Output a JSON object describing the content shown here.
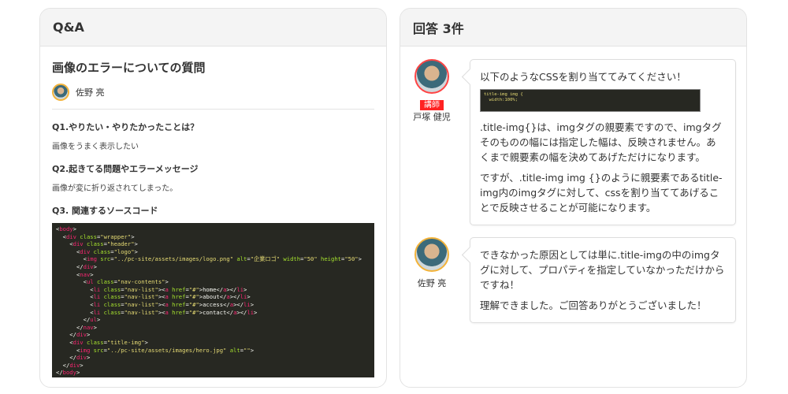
{
  "left": {
    "header": "Q&A",
    "title": "画像のエラーについての質問",
    "author": "佐野 亮",
    "q1": "Q1.やりたい・やりたかったことは？",
    "a1": "画像をうまく表示したい",
    "q2": "Q2.起きてる問題やエラーメッセージ",
    "a2": "画像が変に折り返されてしまった。",
    "q3": "Q3. 関連するソースコード",
    "code": [
      "<body>",
      "  <div class=\"wrapper\">",
      "    <div class=\"header\">",
      "      <div class=\"logo\">",
      "        <img src=\"../pc-site/assets/images/logo.png\" alt=\"企業ロゴ\" width=\"50\" height=\"50\">",
      "      </div>",
      "      <nav>",
      "        <ul class=\"nav-contents\">",
      "          <li class=\"nav-list\"><a href=\"#\">home</a></li>",
      "          <li class=\"nav-list\"><a href=\"#\">about</a></li>",
      "          <li class=\"nav-list\"><a href=\"#\">access</a></li>",
      "          <li class=\"nav-list\"><a href=\"#\">contact</a></li>",
      "        </ul>",
      "      </nav>",
      "    </div>",
      "    <div class=\"title-img\">",
      "      <img src=\"../pc-site/assets/images/hero.jpg\" alt=\"\">",
      "    </div>",
      "  </div>",
      "</body>"
    ]
  },
  "right": {
    "header": "回答 3件",
    "answers": [
      {
        "name": "戸塚 健児",
        "badge": "講師",
        "intro": "以下のようなCSSを割り当ててみてください！",
        "code": [
          "title-img img {",
          "  width:100%;"
        ],
        "paragraphs": [
          ".title-img{}は、imgタグの親要素ですので、imgタグそのものの幅には指定した幅は、反映されません。あくまで親要素の幅を決めてあげただけになります。",
          "ですが、.title-img img {}のように親要素であるtitle-img内のimgタグに対して、cssを割り当ててあげることで反映させることが可能になります。"
        ]
      },
      {
        "name": "佐野 亮",
        "paragraphs": [
          "できなかった原因としては単に.title-imgの中のimgタグに対して、プロパティを指定していなかっただけからですね！",
          "理解できました。ご回答ありがとうございました！"
        ]
      }
    ]
  }
}
